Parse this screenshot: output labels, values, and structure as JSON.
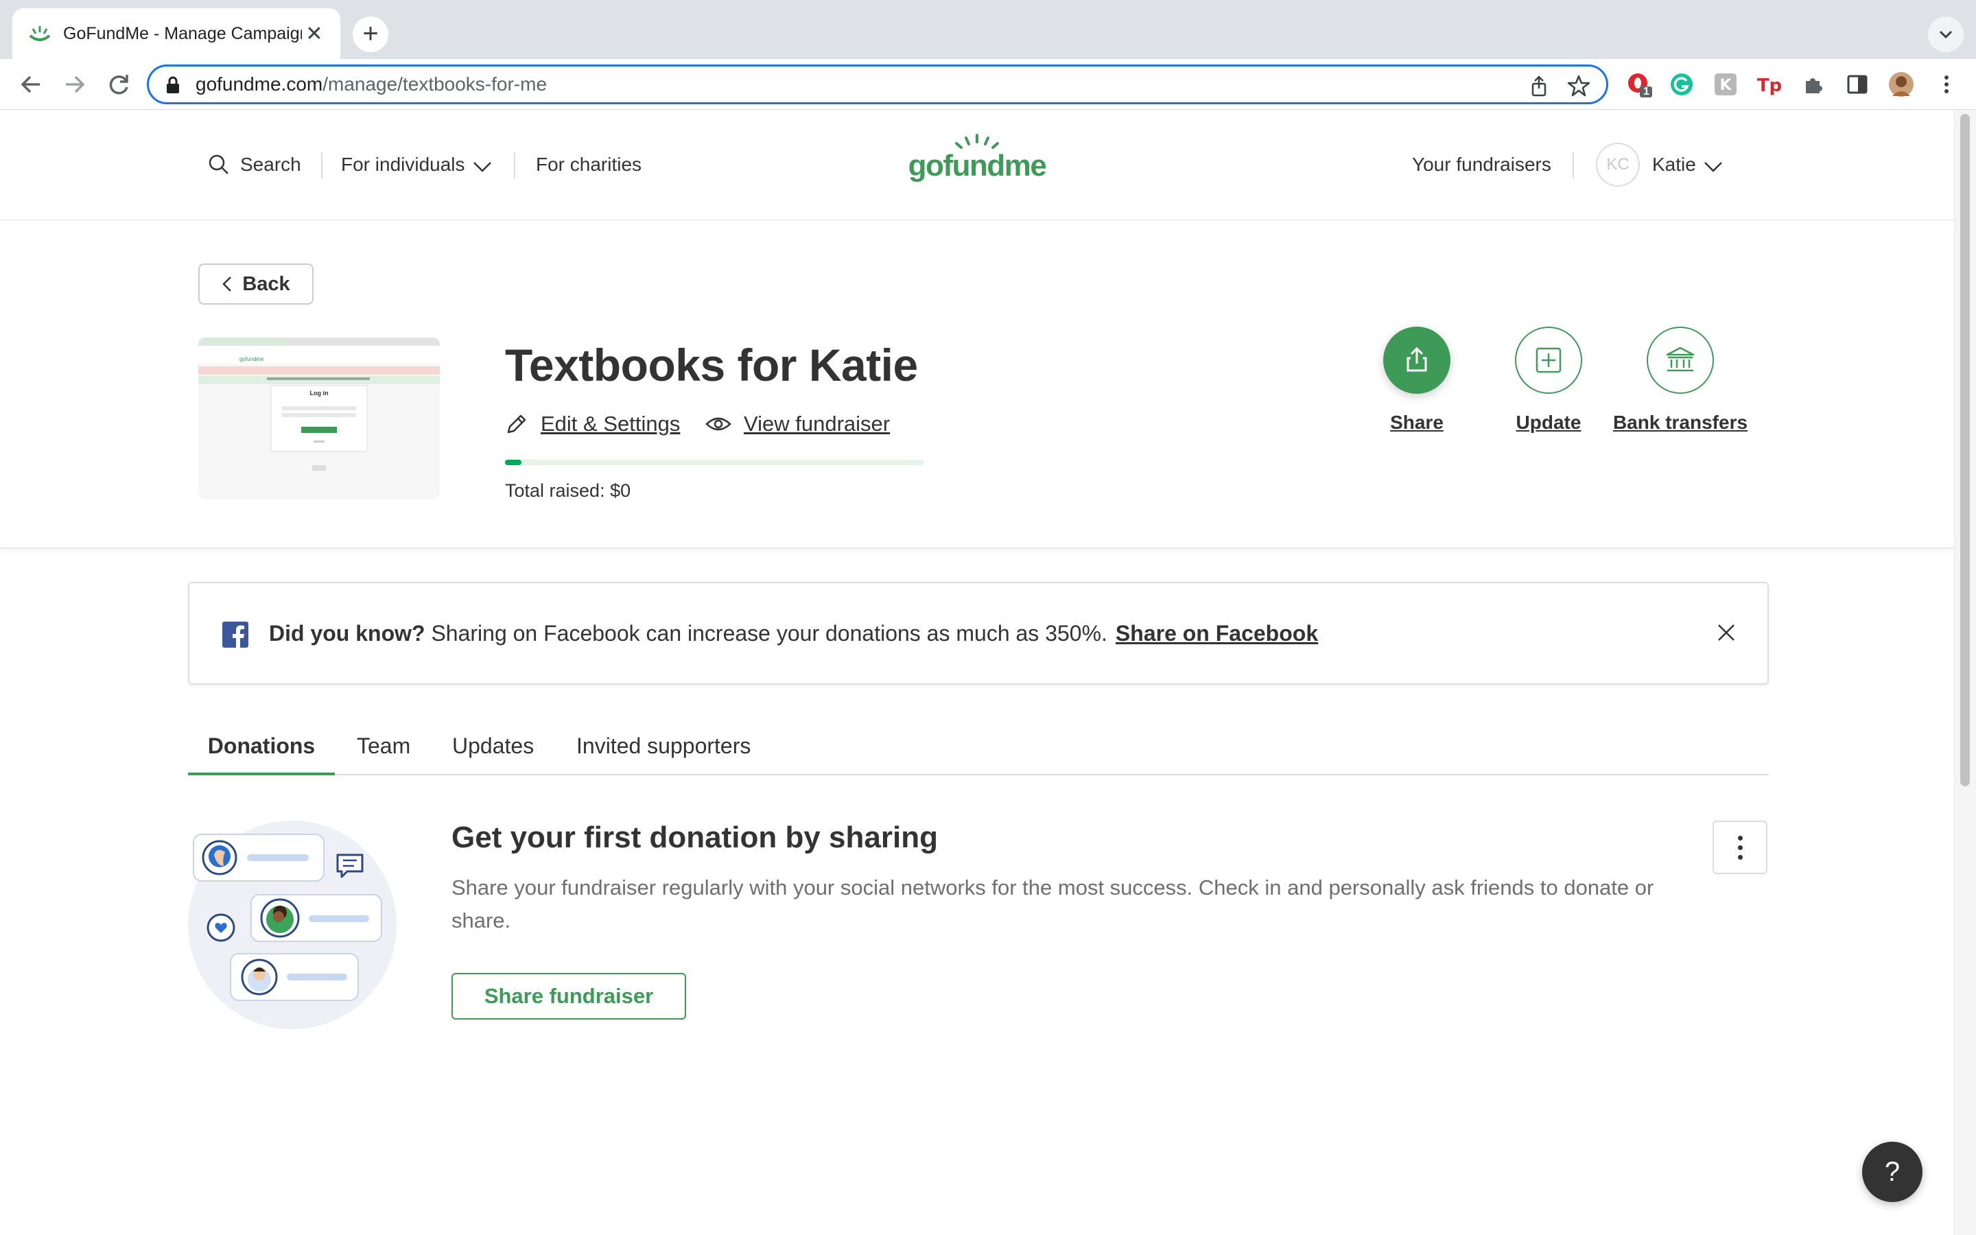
{
  "browser": {
    "tab_title": "GoFundMe - Manage Campaign",
    "tab_close": "✕",
    "new_tab": "+",
    "url_host": "gofundme.com",
    "url_path": "/manage/textbooks-for-me",
    "extension_badge": "1"
  },
  "header": {
    "search_label": "Search",
    "individuals_label": "For individuals",
    "charities_label": "For charities",
    "fundraisers_label": "Your fundraisers",
    "avatar_initials": "KC",
    "user_name": "Katie"
  },
  "campaign": {
    "back_label": "Back",
    "title": "Textbooks for Katie",
    "edit_label": "Edit & Settings",
    "view_label": "View fundraiser",
    "total_raised": "Total raised: $0",
    "progress_percent": 4,
    "thumbnail_heading": "Log in"
  },
  "actions": {
    "share": "Share",
    "update": "Update",
    "bank": "Bank transfers"
  },
  "banner": {
    "lead": "Did you know?",
    "body": " Sharing on Facebook can increase your donations as much as 350%.",
    "link": "Share on Facebook"
  },
  "tabs": [
    "Donations",
    "Team",
    "Updates",
    "Invited supporters"
  ],
  "empty_state": {
    "title": "Get your first donation by sharing",
    "description": "Share your fundraiser regularly with your social networks for the most success. Check in and personally ask friends to donate or share.",
    "button": "Share fundraiser"
  },
  "help_label": "?",
  "colors": {
    "brand_green": "#3d9b57",
    "progress_green": "#02a95c",
    "facebook_blue": "#3b5998",
    "focus_blue": "#1a73e8"
  }
}
